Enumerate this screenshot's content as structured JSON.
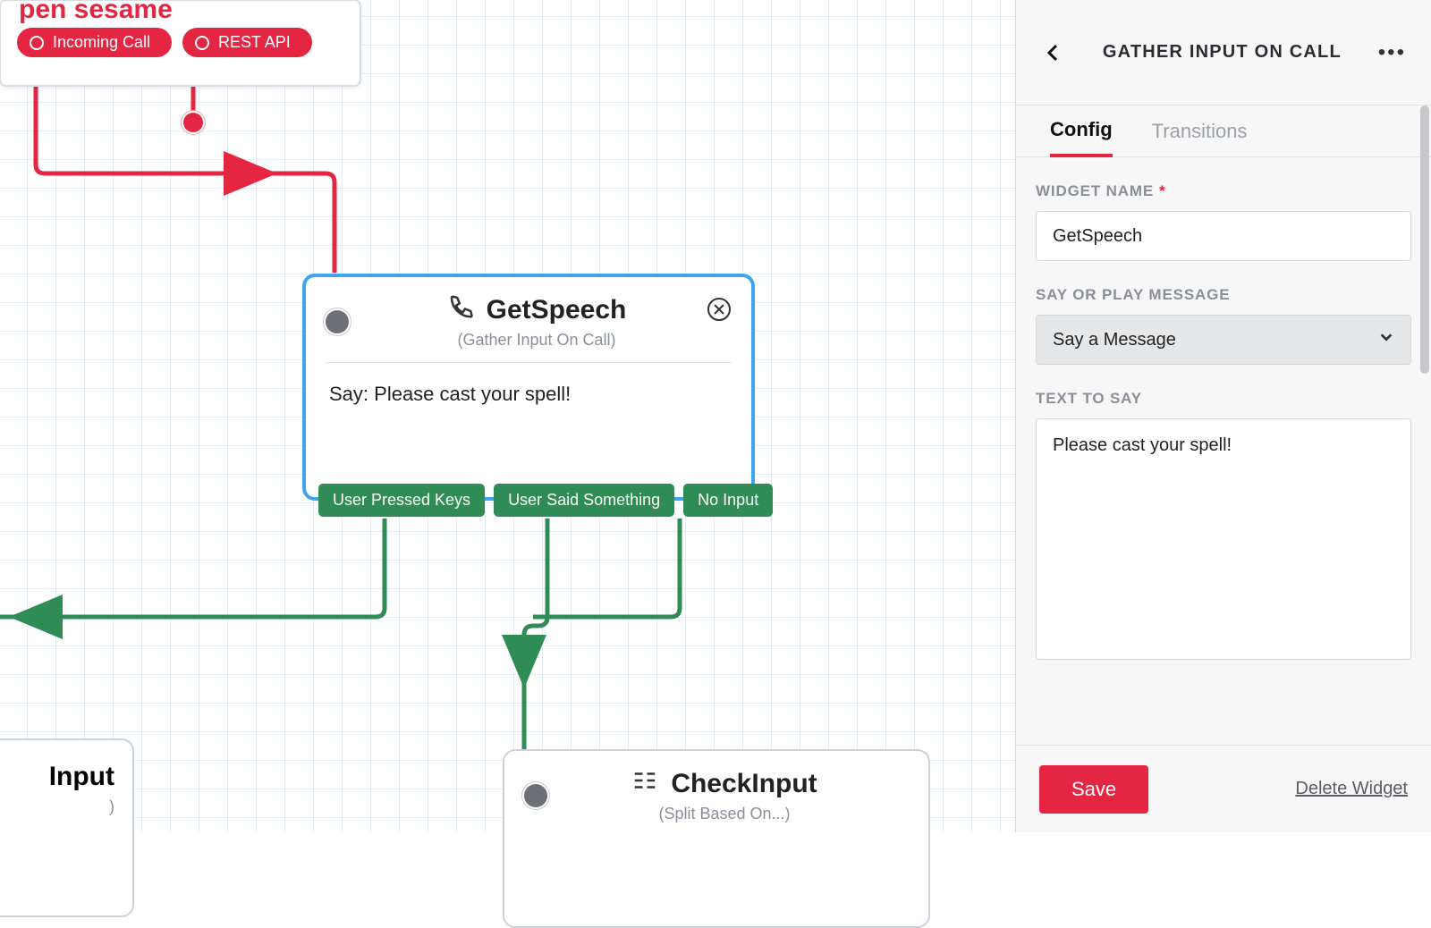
{
  "start": {
    "title": "pen sesame",
    "triggers": [
      {
        "label": "Incoming Call"
      },
      {
        "label": "REST API"
      }
    ]
  },
  "getspeech": {
    "title": "GetSpeech",
    "subtitle": "(Gather Input On Call)",
    "bodyPrefix": "Say: ",
    "bodyText": "Please cast your spell!",
    "outputs": [
      "User Pressed Keys",
      "User Said Something",
      "No Input"
    ]
  },
  "checkinput": {
    "title": "CheckInput",
    "subtitle": "(Split Based On...)"
  },
  "leftwidget": {
    "title": "Input",
    "subtitle": ")"
  },
  "panel": {
    "title": "GATHER INPUT ON CALL",
    "tabs": [
      {
        "label": "Config",
        "active": true
      },
      {
        "label": "Transitions",
        "active": false
      }
    ],
    "widgetNameLabel": "WIDGET NAME",
    "widgetNameValue": "GetSpeech",
    "sayOrPlayLabel": "SAY OR PLAY MESSAGE",
    "sayOrPlayValue": "Say a Message",
    "textToSayLabel": "TEXT TO SAY",
    "textToSayValue": "Please cast your spell!",
    "saveLabel": "Save",
    "deleteLabel": "Delete Widget"
  },
  "colors": {
    "accent": "#e42643",
    "green": "#2f8c55",
    "blue": "#3ea6f0"
  }
}
